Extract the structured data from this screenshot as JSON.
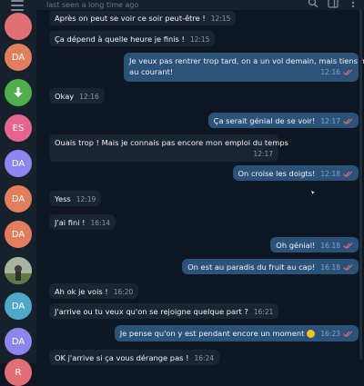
{
  "header": {
    "last_seen": "last seen a long time ago"
  },
  "sidebar": {
    "avatars": [
      {
        "initials": "",
        "color": "#e17076"
      },
      {
        "initials": "DA",
        "color": "#e17e5b"
      },
      {
        "initials": "",
        "color": "#4fae4e"
      },
      {
        "initials": "ES",
        "color": "#e56490"
      },
      {
        "initials": "DA",
        "color": "#8e85ee"
      },
      {
        "initials": "DA",
        "color": "#e17e5b"
      },
      {
        "initials": "DA",
        "color": "#e17e5b"
      },
      {
        "initials": "",
        "color": "#6c8a5a"
      },
      {
        "initials": "DA",
        "color": "#4fa8c7"
      },
      {
        "initials": "DA",
        "color": "#8e85ee"
      },
      {
        "initials": "R",
        "color": "#e17076"
      }
    ]
  },
  "messages": [
    {
      "dir": "in",
      "text": "Après on peut se voir ce soir peut-être !",
      "time": "12:15"
    },
    {
      "dir": "in",
      "text": "Ça dépend à quelle heure je finis !",
      "time": "12:15"
    },
    {
      "dir": "out",
      "line1": "Je veux pas rentrer trop tard, on a un vol demain, mais tiens moi",
      "line2": "au courant!",
      "time": "12:16"
    },
    {
      "dir": "in",
      "text": "Okay",
      "time": "12:16"
    },
    {
      "dir": "out",
      "text": "Ça serait génial de se voir!",
      "time": "12:17"
    },
    {
      "dir": "in",
      "text": "Ouais trop ! Mais je connais pas encore mon emploi du temps",
      "time": "12:17"
    },
    {
      "dir": "out",
      "text": "On croise les doigts!",
      "time": "12:18"
    },
    {
      "dir": "in",
      "text": "Yess",
      "time": "12:19"
    },
    {
      "dir": "in",
      "text": "J'ai fini !",
      "time": "16:14"
    },
    {
      "dir": "out",
      "text": "Oh génial!",
      "time": "16:18"
    },
    {
      "dir": "out",
      "text": "On est au paradis du fruit au cap!",
      "time": "16:18"
    },
    {
      "dir": "in",
      "text": "Ah ok je vois !",
      "time": "16:20"
    },
    {
      "dir": "in",
      "text": "J'arrive ou tu veux qu'on se rejoigne quelque part ?",
      "time": "16:21"
    },
    {
      "dir": "out",
      "text": "Je pense qu'on y est pendant encore un moment",
      "time": "16:23"
    },
    {
      "dir": "in",
      "text": "OK j'arrive si ça vous dérange pas !",
      "time": "16:24"
    }
  ],
  "colors": {
    "background": "#0e1621",
    "incoming_bubble": "#182533",
    "outgoing_bubble": "#2b5278",
    "read_ticks": "#e06c75"
  }
}
